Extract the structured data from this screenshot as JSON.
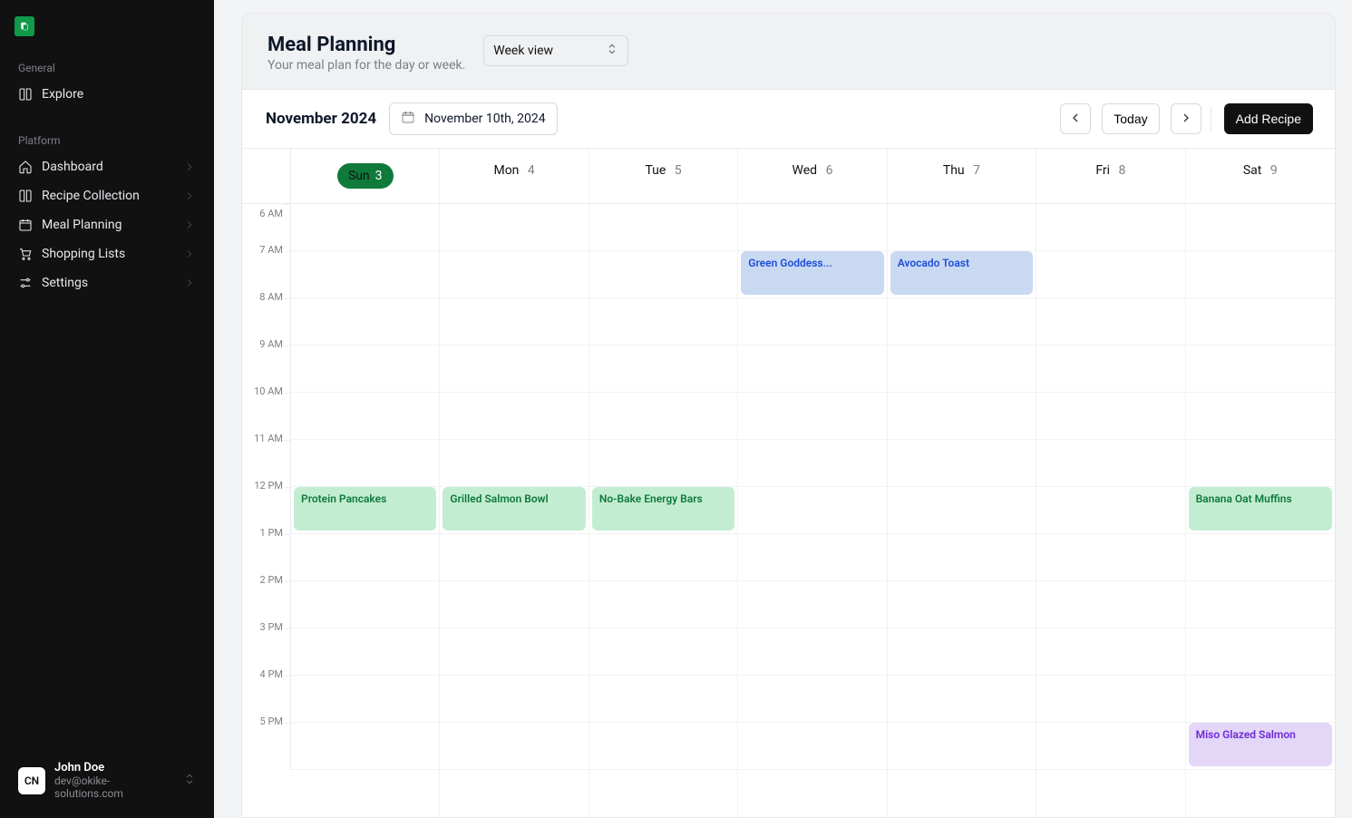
{
  "sidebar": {
    "sections": [
      {
        "label": "General",
        "items": [
          {
            "label": "Explore",
            "icon": "book",
            "hasSubmenu": false,
            "name": "nav-explore"
          }
        ]
      },
      {
        "label": "Platform",
        "items": [
          {
            "label": "Dashboard",
            "icon": "home",
            "hasSubmenu": true,
            "name": "nav-dashboard"
          },
          {
            "label": "Recipe Collection",
            "icon": "book",
            "hasSubmenu": true,
            "name": "nav-recipes"
          },
          {
            "label": "Meal Planning",
            "icon": "calendar",
            "hasSubmenu": true,
            "name": "nav-meal-planning"
          },
          {
            "label": "Shopping Lists",
            "icon": "cart",
            "hasSubmenu": true,
            "name": "nav-shopping"
          },
          {
            "label": "Settings",
            "icon": "sliders",
            "hasSubmenu": true,
            "name": "nav-settings"
          }
        ]
      }
    ],
    "user": {
      "initials": "CN",
      "name": "John Doe",
      "email": "dev@okike-solutions.com"
    }
  },
  "page": {
    "title": "Meal Planning",
    "subtitle": "Your meal plan for the day or week.",
    "viewSelect": {
      "value": "Week view"
    },
    "monthLabel": "November 2024",
    "datePicker": "November 10th, 2024",
    "todayLabel": "Today",
    "addRecipeLabel": "Add Recipe"
  },
  "calendar": {
    "startHour": 6,
    "endHour": 17,
    "hourLabels": [
      "6 AM",
      "7 AM",
      "8 AM",
      "9 AM",
      "10 AM",
      "11 AM",
      "12 PM",
      "1 PM",
      "2 PM",
      "3 PM",
      "4 PM",
      "5 PM"
    ],
    "days": [
      {
        "dow": "Sun",
        "num": 3,
        "isToday": true
      },
      {
        "dow": "Mon",
        "num": 4
      },
      {
        "dow": "Tue",
        "num": 5
      },
      {
        "dow": "Wed",
        "num": 6
      },
      {
        "dow": "Thu",
        "num": 7
      },
      {
        "dow": "Fri",
        "num": 8
      },
      {
        "dow": "Sat",
        "num": 9
      }
    ],
    "events": [
      {
        "dayIndex": 3,
        "startHour": 7,
        "title": "Green Goddess...",
        "color": "blue"
      },
      {
        "dayIndex": 4,
        "startHour": 7,
        "title": "Avocado Toast",
        "color": "blue"
      },
      {
        "dayIndex": 0,
        "startHour": 12,
        "title": "Protein Pancakes",
        "color": "green"
      },
      {
        "dayIndex": 1,
        "startHour": 12,
        "title": "Grilled Salmon Bowl",
        "color": "green"
      },
      {
        "dayIndex": 2,
        "startHour": 12,
        "title": "No-Bake Energy Bars",
        "color": "green"
      },
      {
        "dayIndex": 6,
        "startHour": 12,
        "title": "Banana Oat Muffins",
        "color": "green"
      },
      {
        "dayIndex": 6,
        "startHour": 17,
        "title": "Miso Glazed Salmon",
        "color": "purple"
      }
    ]
  }
}
